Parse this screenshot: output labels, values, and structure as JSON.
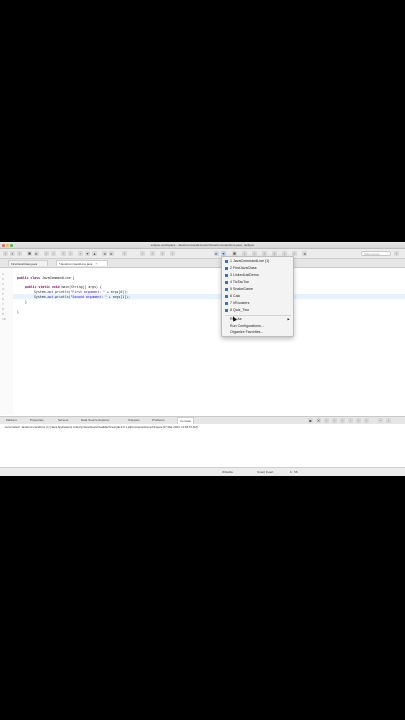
{
  "window": {
    "title": "eclipse-workspace - JavaCommandLine/src/JavaCommandLine.java - Eclipse"
  },
  "toolbar": {
    "quick_access_placeholder": "Quick Access"
  },
  "editor_tabs": [
    {
      "label": "FirstJavaClass.java"
    },
    {
      "label": "*JavaCommandLine.java",
      "close": "⨯"
    }
  ],
  "code": {
    "line_numbers": [
      "1",
      "2",
      "3",
      "4",
      "5",
      "6",
      "7",
      "8",
      "9",
      "10"
    ],
    "lines": [
      {
        "kw": "public class",
        "rest": " JavaCommandLine {"
      },
      {
        "kw": "public static void",
        "rest": " main(String[] args) {"
      },
      {
        "pre": "System.",
        "fld": "out",
        "post": ".println(",
        "str": "\"First argument: \"",
        "tail": " + args[0]);"
      },
      {
        "pre": "System.",
        "fld": "out",
        "post": ".println(",
        "str": "\"Second argument: \"",
        "tail": " + args[1]);"
      },
      {
        "text": "}"
      },
      {
        "text": "}"
      }
    ]
  },
  "run_menu": {
    "history": [
      "1 JavaCommandLine (1)",
      "2 FirstJavaClass",
      "3 LinkedListDemo",
      "4 TicTacToe",
      "5 SnakeGame",
      "6 Calc",
      "7 hRoosters",
      "8 Quiz_Two"
    ],
    "run_as": "Run As",
    "run_as_arrow": "▶",
    "run_configurations": "Run Configurations...",
    "organize_favorites": "Organize Favorites..."
  },
  "view_tabs": [
    {
      "label": "Markers"
    },
    {
      "label": "Properties"
    },
    {
      "label": "Servers"
    },
    {
      "label": "Data Source Explorer"
    },
    {
      "label": "Snippets"
    },
    {
      "label": "Problems"
    },
    {
      "label": "Console",
      "active": true
    }
  ],
  "console": {
    "text": "<terminated> JavaCommandLine (1) [Java Application] /Library/Java/JavaVirtualMachines/jdk-9.0.1.jdk/Contents/Home/bin/java (07-Mar-2023, 12:06:57 AM)"
  },
  "status_bar": {
    "writable": "Writable",
    "insert_mode": "Smart Insert",
    "position": "6 : 58"
  },
  "colors": {
    "menu_icon": "#2f6fcf",
    "keyword": "#7f0055",
    "string": "#2a00ff",
    "field": "#0000c0"
  }
}
